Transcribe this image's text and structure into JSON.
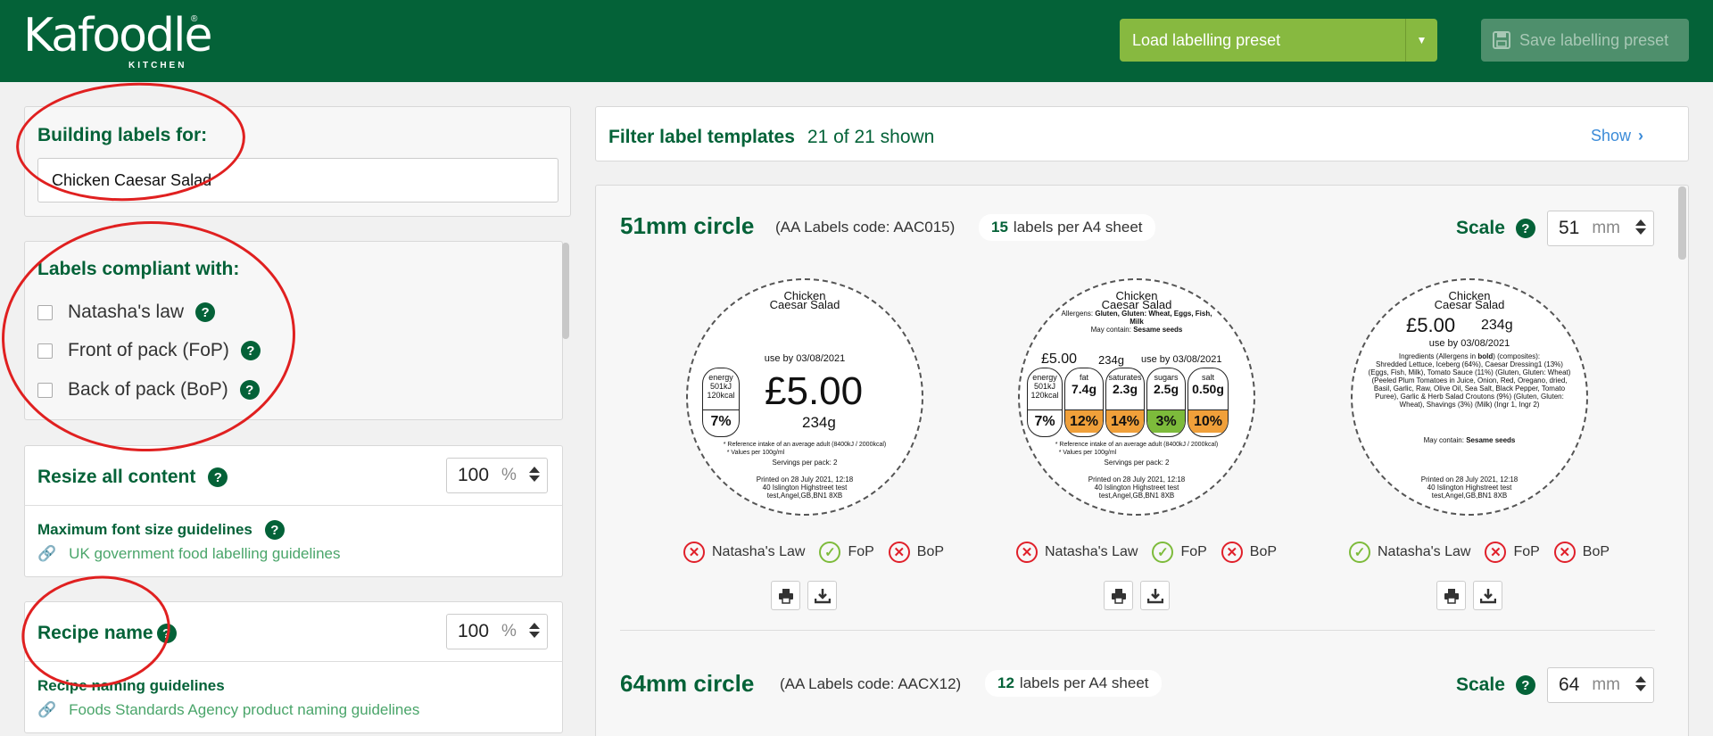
{
  "header": {
    "logo_text": "Kafoodle",
    "logo_sub": "KITCHEN",
    "load_preset_label": "Load labelling preset",
    "save_preset_label": "Save labelling preset",
    "brand_color": "#046238",
    "accent_color": "#87b940"
  },
  "sidebar": {
    "building_for_label": "Building labels for:",
    "recipe_input_value": "Chicken Caesar Salad",
    "compliant_label": "Labels compliant with:",
    "compliance_options": [
      "Natasha's law",
      "Front of pack (FoP)",
      "Back of pack (BoP)"
    ],
    "resize_label": "Resize all content",
    "resize_value": "100",
    "percent_unit": "%",
    "max_font_label": "Maximum font size guidelines",
    "max_font_link": "UK government food labelling guidelines",
    "recipe_name_label": "Recipe name",
    "recipe_name_value": "100",
    "naming_guidelines_label": "Recipe naming guidelines",
    "naming_guidelines_link": "Foods Standards Agency product naming guidelines"
  },
  "filter": {
    "label": "Filter label templates",
    "shown_text": "21 of 21 shown",
    "show_label": "Show"
  },
  "templates": [
    {
      "name": "51mm circle",
      "aa_code": "(AA Labels code: AAC015)",
      "per_sheet_count": "15",
      "per_sheet_text": "labels per A4 sheet",
      "scale_label": "Scale",
      "scale_value": "51",
      "scale_unit": "mm"
    },
    {
      "name": "64mm circle",
      "aa_code": "(AA Labels code: AACX12)",
      "per_sheet_count": "12",
      "per_sheet_text": "labels per A4 sheet",
      "scale_label": "Scale",
      "scale_value": "64",
      "scale_unit": "mm"
    }
  ],
  "labels": {
    "name_line1": "Chicken",
    "name_line2": "Caesar Salad",
    "use_by": "use by 03/08/2021",
    "price": "£5.00",
    "weight": "234g",
    "ref_intake": "* Reference intake of an average adult (8400kJ / 2000kcal)",
    "per_100": "* Values per 100g/ml",
    "servings": "Servings per pack: 2",
    "printed_on": "Printed on 28 July 2021, 12:18",
    "address_1": "40 Islington Highstreet test",
    "address_2": "test,Angel,GB,BN1 8XB",
    "energy_label": "energy",
    "energy_kj": "501kJ",
    "energy_kcal": "120kcal",
    "energy_pct": "7%",
    "allergens_prefix": "Allergens:",
    "allergens_bold": "Gluten, Gluten: Wheat, Eggs, Fish, Milk",
    "may_contain_prefix": "May contain:",
    "may_contain_bold": "Sesame seeds",
    "nutrients": [
      {
        "name": "fat",
        "value": "7.4g",
        "pct": "12%",
        "color": "#f0a03a"
      },
      {
        "name": "saturates",
        "value": "2.3g",
        "pct": "14%",
        "color": "#f0a03a"
      },
      {
        "name": "sugars",
        "value": "2.5g",
        "pct": "3%",
        "color": "#7dbb3b"
      },
      {
        "name": "salt",
        "value": "0.50g",
        "pct": "10%",
        "color": "#f0a03a"
      }
    ],
    "ingredients_intro": "Ingredients (Allergens in",
    "ingredients_bold_word": "bold",
    "ingredients_intro_end": ") (composites):",
    "ingredients_text": "Shredded Lettuce, Iceberg (64%), Caesar Dressing1 (13%) (Eggs, Fish, Milk), Tomato Sauce (11%) (Gluten, Gluten: Wheat) (Peeled Plum Tomatoes in Juice, Onion, Red, Oregano, dried, Basil, Garlic, Raw, Olive Oil, Sea Salt, Black Pepper, Tomato Puree), Garlic & Herb Salad Croutons (9%) (Gluten, Gluten: Wheat), Shavings (3%) (Milk) (Ingr 1, Ingr 2)",
    "compliance_names": [
      "Natasha's Law",
      "FoP",
      "BoP"
    ],
    "compliance_status": [
      [
        "fail",
        "pass",
        "fail"
      ],
      [
        "fail",
        "pass",
        "fail"
      ],
      [
        "pass",
        "fail",
        "fail"
      ]
    ]
  }
}
